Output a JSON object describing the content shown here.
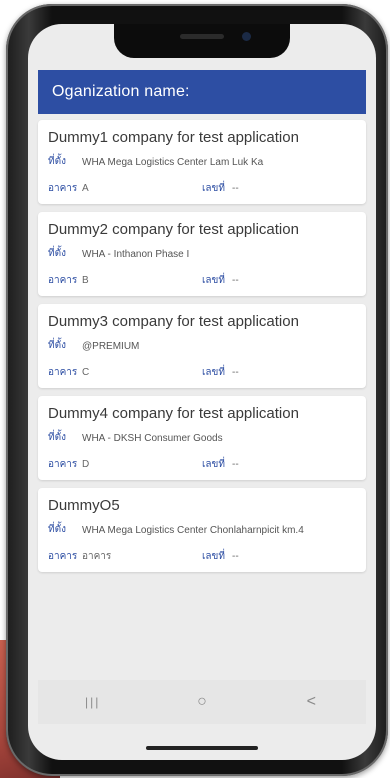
{
  "header": {
    "title": "Oganization name:"
  },
  "labels": {
    "location": "ที่ตั้ง",
    "building": "อาคาร",
    "number": "เลขที่"
  },
  "companies": [
    {
      "name": "Dummy1 company for test application",
      "location": "WHA Mega Logistics Center Lam Luk Ka",
      "building": "A",
      "number": "--"
    },
    {
      "name": "Dummy2 company for test application",
      "location": "WHA - Inthanon Phase I",
      "building": "B",
      "number": "--"
    },
    {
      "name": "Dummy3 company for test application",
      "location": "@PREMIUM",
      "building": "C",
      "number": "--"
    },
    {
      "name": "Dummy4 company for test application",
      "location": "WHA - DKSH Consumer Goods",
      "building": "D",
      "number": "--"
    },
    {
      "name": "DummyO5",
      "location": "WHA Mega Logistics Center Chonlaharnpicit km.4",
      "building": "อาคาร",
      "number": "--"
    }
  ],
  "navbar": {
    "recents": "|||",
    "home": "○",
    "back": "<"
  },
  "icons": [
    "recents-icon",
    "home-icon",
    "back-icon"
  ],
  "colors": {
    "header": "#2d4ea3",
    "label": "#2d4ea3"
  }
}
